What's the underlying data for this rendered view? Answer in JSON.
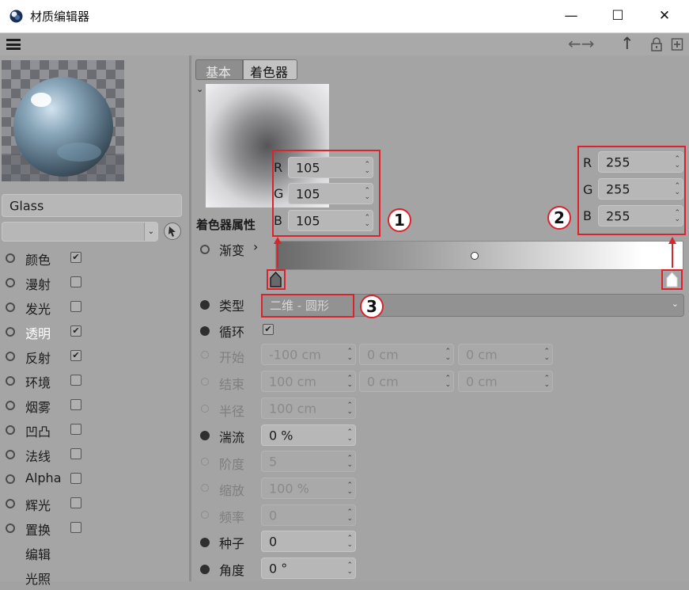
{
  "window": {
    "title": "材质编辑器",
    "minimize": "—",
    "maximize": "☐",
    "close": "✕"
  },
  "toolbar": {
    "arrows": "←→",
    "up": "↑"
  },
  "material": {
    "name": "Glass"
  },
  "channels": [
    {
      "label": "颜色",
      "checked": true,
      "checkmark": "✔"
    },
    {
      "label": "漫射",
      "checked": false,
      "checkmark": ""
    },
    {
      "label": "发光",
      "checked": false,
      "checkmark": ""
    },
    {
      "label": "透明",
      "checked": true,
      "checkmark": "✔"
    },
    {
      "label": "反射",
      "checked": true,
      "checkmark": "✔"
    },
    {
      "label": "环境",
      "checked": false,
      "checkmark": ""
    },
    {
      "label": "烟雾",
      "checked": false,
      "checkmark": ""
    },
    {
      "label": "凹凸",
      "checked": false,
      "checkmark": ""
    },
    {
      "label": "法线",
      "checked": false,
      "checkmark": ""
    },
    {
      "label": "Alpha",
      "checked": false,
      "checkmark": ""
    },
    {
      "label": "辉光",
      "checked": false,
      "checkmark": ""
    },
    {
      "label": "置换",
      "checked": false,
      "checkmark": ""
    }
  ],
  "extra_items": [
    "编辑",
    "光照"
  ],
  "tabs": [
    {
      "label": "基本",
      "active": false
    },
    {
      "label": "着色器",
      "active": true
    }
  ],
  "shader_props_title": "着色器属性",
  "gradient": {
    "label": "渐变",
    "chevron": "›",
    "left_color": {
      "r": "105",
      "g": "105",
      "b": "105"
    },
    "right_color": {
      "r": "255",
      "g": "255",
      "b": "255"
    },
    "channel_r": "R",
    "channel_g": "G",
    "channel_b": "B"
  },
  "type_row": {
    "label": "类型",
    "value": "二维 - 圆形"
  },
  "loop_row": {
    "label": "循环",
    "checked": true,
    "checkmark": "✔"
  },
  "start_row": {
    "label": "开始",
    "v1": "-100 cm",
    "v2": "0 cm",
    "v3": "0 cm"
  },
  "end_row": {
    "label": "结束",
    "v1": "100 cm",
    "v2": "0 cm",
    "v3": "0 cm"
  },
  "radius_row": {
    "label": "半径",
    "value": "100 cm"
  },
  "turbulence_row": {
    "label": "湍流",
    "value": "0 %"
  },
  "octaves_row": {
    "label": "阶度",
    "value": "5"
  },
  "scale_row": {
    "label": "缩放",
    "value": "100 %"
  },
  "frequency_row": {
    "label": "频率",
    "value": "0"
  },
  "seed_row": {
    "label": "种子",
    "value": "0"
  },
  "angle_row": {
    "label": "角度",
    "value": "0 °"
  },
  "annotations": [
    "1",
    "2",
    "3"
  ],
  "colors": {
    "annotation_red": "#d9232d",
    "panel_gray": "#a4a4a4"
  }
}
